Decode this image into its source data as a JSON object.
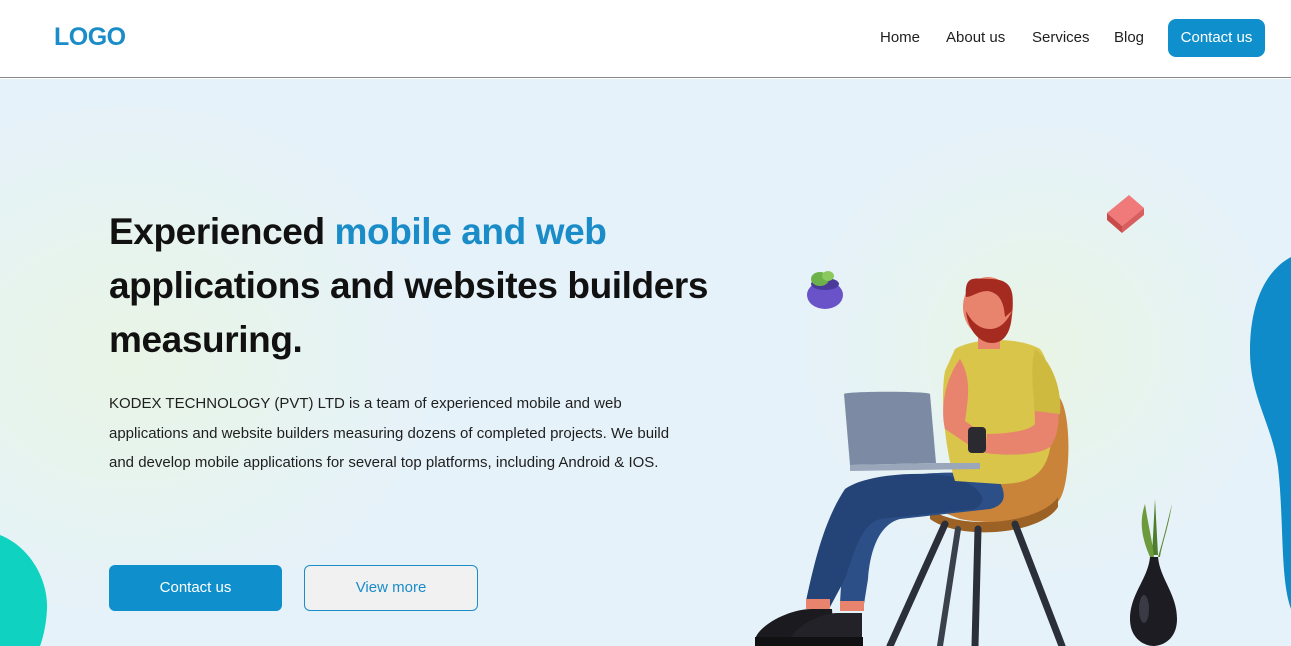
{
  "nav": {
    "logo": "LOGO",
    "links": [
      {
        "label": "Home"
      },
      {
        "label": "About us"
      },
      {
        "label": "Services"
      },
      {
        "label": "Blog"
      }
    ],
    "cta_label": "Contact us"
  },
  "hero": {
    "headline_part1": "Experienced ",
    "headline_accent": "mobile and web",
    "headline_part2": "applications and websites builders measuring.",
    "description": "KODEX TECHNOLOGY (PVT) LTD is a team of experienced mobile and web applications and website builders measuring dozens of completed projects. We build and develop mobile applications for several top platforms, including Android & IOS.",
    "primary_button": "Contact us",
    "secondary_button": "View more"
  },
  "colors": {
    "brand": "#1a8cc8",
    "button": "#0f8fcb",
    "hero_background": "#e6f2f9",
    "teal_blob": "#0fd3c0"
  },
  "illustration": {
    "icons": [
      "person-with-laptop-icon",
      "chair-icon",
      "plant-pot-icon",
      "vase-icon",
      "brick-icon"
    ]
  }
}
